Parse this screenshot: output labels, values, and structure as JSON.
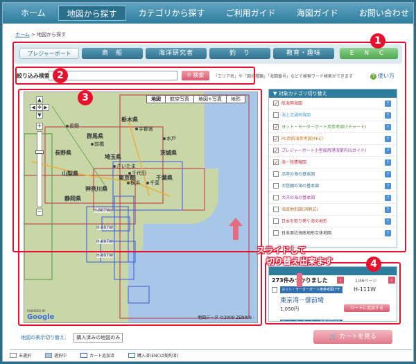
{
  "nav": {
    "items": [
      "ホーム",
      "地図から探す",
      "カテゴリから探す",
      "ご利用ガイド",
      "海図ガイド",
      "お問い合わせ"
    ],
    "active_index": 1
  },
  "breadcrumb": {
    "home": "ホーム",
    "separator": ">",
    "current": "地図から探す"
  },
  "category_tabs": [
    "プレジャーボート",
    "商　船",
    "海洋研究者",
    "釣　り",
    "教育・趣味",
    "E N C"
  ],
  "search": {
    "label": "絞り込み検索",
    "value": "",
    "button": "検索",
    "hint": "「エリア名」や「図の種類」「海図番号」などで検索ワード検索ができます"
  },
  "help_link": "使い方",
  "map": {
    "types": [
      "地図",
      "航空写真",
      "地図+写真",
      "地形"
    ],
    "active_type": "地図",
    "prefectures": [
      "栃木県",
      "群馬県",
      "茨城県",
      "長野県",
      "埼玉県",
      "東京都",
      "神奈川県",
      "千葉県",
      "山梨県",
      "静岡県"
    ],
    "cities": [
      "長野",
      "宇都宮",
      "前橋",
      "水戸",
      "さいたま",
      "千代田",
      "横浜",
      "千葉"
    ],
    "chart_codes": [
      "H-807W",
      "H-807W",
      "H-807W",
      "H-807W"
    ],
    "credit": "地図データ ©2009 ZENRIN -",
    "powered_by": "POWERED BY",
    "logo": "Google"
  },
  "sidebar": {
    "title": "対象カテゴリ切り替え",
    "categories": [
      {
        "label": "航海用海図",
        "checked": true,
        "color": "#c0303a"
      },
      {
        "label": "海上交通特殊図",
        "checked": false,
        "color": "#4aa0c8"
      },
      {
        "label": "ヨット・モーターボート用参考図(Yチャート)",
        "checked": true,
        "color": "#4a9a3a"
      },
      {
        "label": "PC用航海参考図(PEC)",
        "checked": true,
        "color": "#d0701a"
      },
      {
        "label": "プレジャーボート小型船用港湾案内(Sガイド)",
        "checked": true,
        "color": "#9a3aa8"
      },
      {
        "label": "海・陸情報図",
        "checked": true,
        "color": "#c0303a"
      },
      {
        "label": "沿岸の海の基本図",
        "checked": false,
        "color": "#2a6f8b"
      },
      {
        "label": "大陸棚の海の基本図",
        "checked": false,
        "color": "#2a6f8b"
      },
      {
        "label": "大洋の海の基本図",
        "checked": false,
        "color": "#a8409a"
      },
      {
        "label": "海底地形図(消刷式)",
        "checked": false,
        "color": "#a86a2a"
      },
      {
        "label": "日本を取り巻く海の地形",
        "checked": false,
        "color": "#c0303a"
      },
      {
        "label": "日本周辺海底地形立体地図",
        "checked": false,
        "color": "#333333"
      }
    ]
  },
  "results": {
    "count": "273件みつかりました",
    "page": "1/46ページ",
    "item": {
      "type": "ヨット・モーターボート用参考図(Yチ...",
      "code": "H-111W",
      "name": "東京湾－御前埼",
      "price": "1,050円",
      "add_button": "カートに追加する"
    },
    "next_item_type": "ヨット・モーターボート用参考図(Yチ..."
  },
  "display_toggle": {
    "label": "地図の表示切り替え：",
    "option": "購入済みの地図のみ"
  },
  "cart_button": "カートを見る",
  "legend": [
    {
      "label": "未選択",
      "color": "#ffffff"
    },
    {
      "label": "選択中",
      "color": "#a8c8e8"
    },
    {
      "label": "カート追加済",
      "color": "#ffffff"
    },
    {
      "label": "購入済(ENCは契約済)",
      "color": "#ffffff"
    }
  ],
  "annotations": {
    "numbers": [
      "1",
      "2",
      "3",
      "4"
    ],
    "slide_note_line1": "スライドして",
    "slide_note_line2": "切り替え出来ます",
    "color": "#e8112d"
  }
}
